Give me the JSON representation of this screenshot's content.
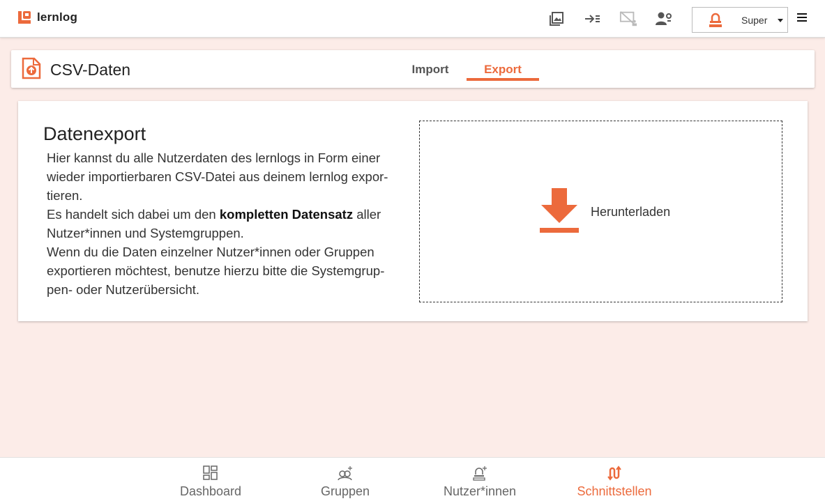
{
  "app": {
    "name": "lernlog",
    "brand_color": "#ec6a3c"
  },
  "topbar": {
    "icons": [
      "gallery-icon",
      "login-arrow-icon",
      "screen-off-icon",
      "user-settings-icon"
    ],
    "user_name": "Super"
  },
  "header": {
    "title": "CSV-Daten",
    "tabs": [
      {
        "label": "Import",
        "active": false
      },
      {
        "label": "Export",
        "active": true
      }
    ]
  },
  "export": {
    "heading": "Datenexport",
    "paragraph1": "Hier kannst du alle Nutzerdaten des lernlogs in Form einer wieder importierbaren CSV-Datei aus deinem lernlog expor­tieren.",
    "paragraph2_pre": "Es handelt sich dabei um den ",
    "paragraph2_bold": "kompletten Datensatz",
    "paragraph2_post": " aller Nutzer*innen und Systemgruppen.",
    "paragraph3": "Wenn du die Daten einzelner Nutzer*innen oder Gruppen exportieren möchtest, benutze hierzu bitte die Systemgrup­pen- oder Nutzerübersicht.",
    "download_label": "Herunterladen"
  },
  "bottomnav": {
    "items": [
      {
        "label": "Dashboard",
        "icon": "dashboard-icon",
        "active": false
      },
      {
        "label": "Gruppen",
        "icon": "groups-icon",
        "active": false
      },
      {
        "label": "Nutzer*innen",
        "icon": "user-icon",
        "active": false
      },
      {
        "label": "Schnittstellen",
        "icon": "interfaces-icon",
        "active": true
      }
    ]
  }
}
